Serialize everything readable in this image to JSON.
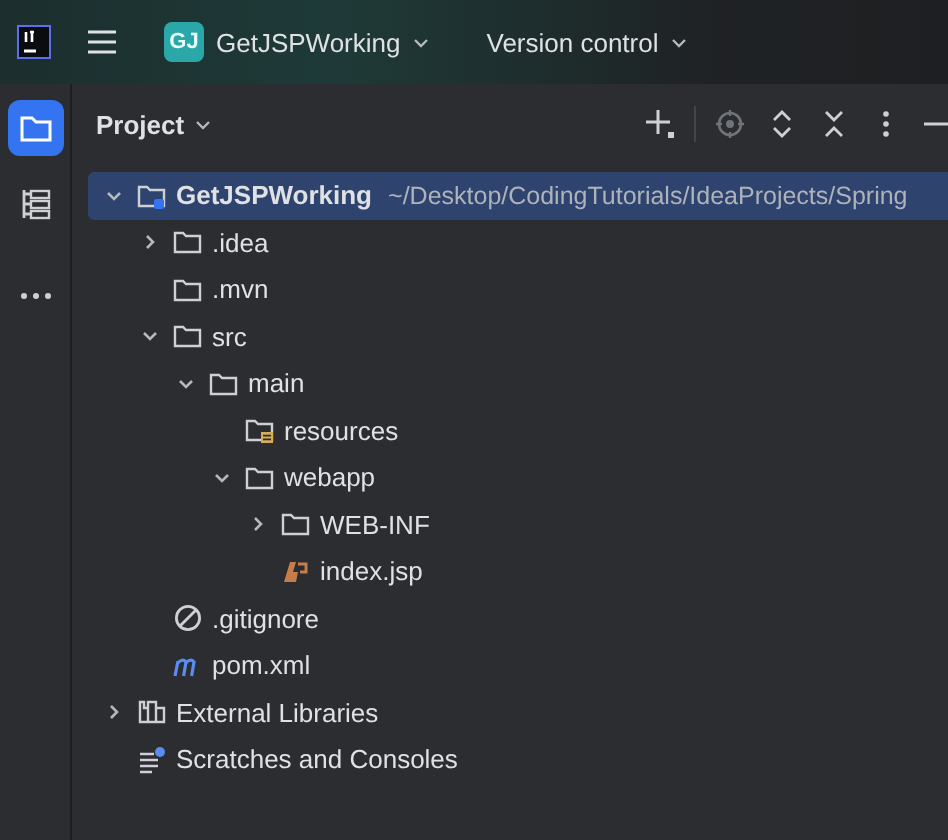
{
  "title_bar": {
    "project_badge": "GJ",
    "project": "GetJSPWorking",
    "vcs": "Version control"
  },
  "tool_strip": [
    {
      "kind": "project",
      "selected": true
    },
    {
      "kind": "structure",
      "selected": false
    },
    {
      "kind": "more",
      "selected": false
    }
  ],
  "panel": {
    "title": "Project"
  },
  "tree": [
    {
      "label": "GetJSPWorking",
      "hint": "~/Desktop/CodingTutorials/IdeaProjects/Spring",
      "kind": "module",
      "expanded": true,
      "selected": true,
      "children": [
        {
          "label": ".idea",
          "kind": "folder",
          "expanded": false,
          "selected": false
        },
        {
          "label": ".mvn",
          "kind": "folder",
          "selected": false
        },
        {
          "label": "src",
          "kind": "folder",
          "expanded": true,
          "selected": false,
          "children": [
            {
              "label": "main",
              "kind": "folder",
              "expanded": true,
              "selected": false,
              "children": [
                {
                  "label": "resources",
                  "kind": "resources",
                  "selected": false
                },
                {
                  "label": "webapp",
                  "kind": "folder",
                  "expanded": true,
                  "selected": false,
                  "children": [
                    {
                      "label": "WEB-INF",
                      "kind": "folder",
                      "expanded": false,
                      "selected": false
                    },
                    {
                      "label": "index.jsp",
                      "kind": "jsp",
                      "selected": false
                    }
                  ]
                }
              ]
            }
          ]
        },
        {
          "label": ".gitignore",
          "kind": "ignore",
          "selected": false
        },
        {
          "label": "pom.xml",
          "kind": "maven",
          "selected": false
        }
      ]
    },
    {
      "label": "External Libraries",
      "kind": "libraries",
      "expanded": false,
      "selected": false
    },
    {
      "label": "Scratches and Consoles",
      "kind": "scratches",
      "selected": false
    }
  ]
}
